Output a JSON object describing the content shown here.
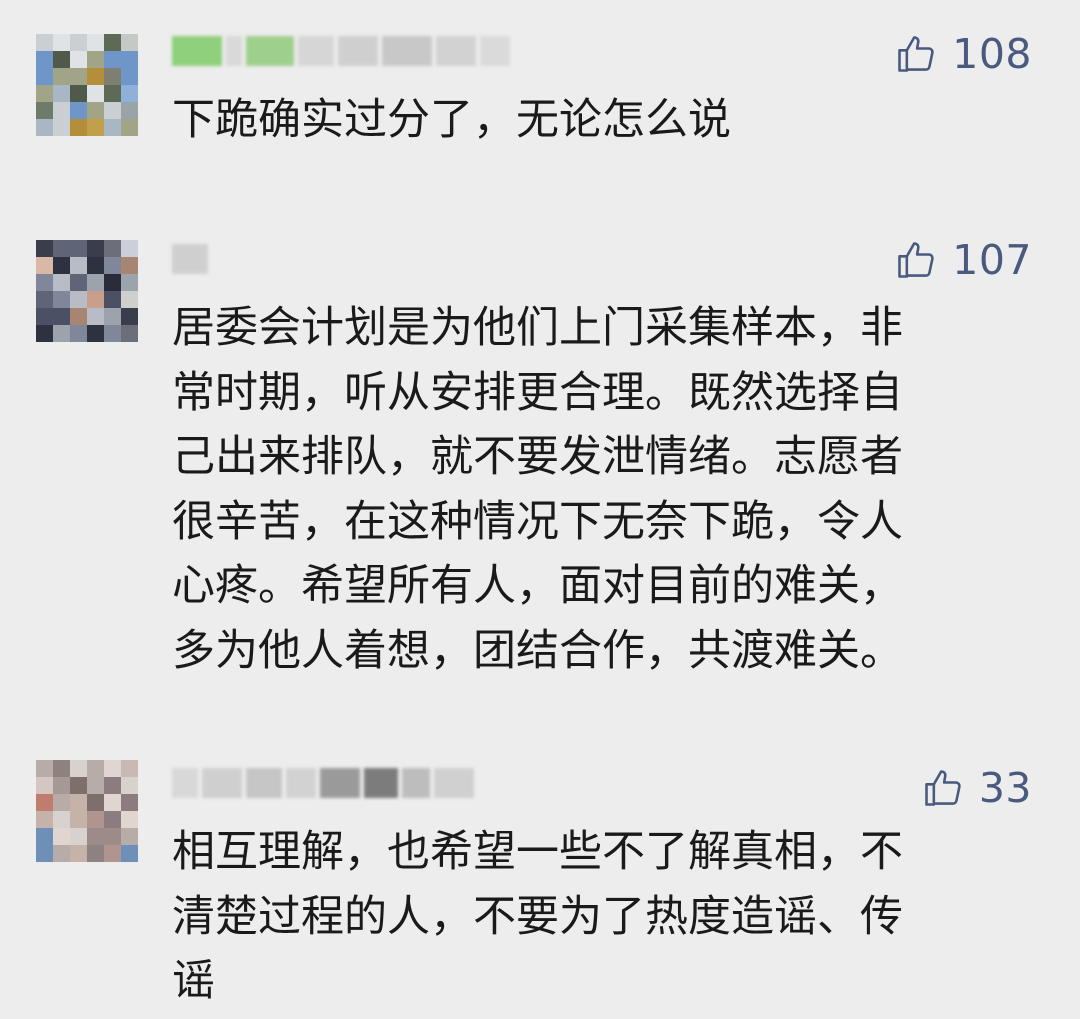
{
  "comments": [
    {
      "likes": "108",
      "lines": [
        "下跪确实过分了，无论怎么说"
      ]
    },
    {
      "likes": "107",
      "lines": [
        "居委会计划是为他们上门采集样本，非",
        "常时期，听从安排更合理。既然选择自",
        "己出来排队，就不要发泄情绪。志愿者",
        "很辛苦，在这种情况下无奈下跪，令人",
        "心疼。希望所有人，面对目前的难关，",
        "多为他人着想，团结合作，共渡难关。"
      ]
    },
    {
      "likes": "33",
      "lines": [
        "相互理解，也希望一些不了解真相，不",
        "清楚过程的人，不要为了热度造谣、传",
        "谣"
      ]
    }
  ],
  "icons": {
    "like": "thumbs-up-icon",
    "avatar": "pixelated-avatar",
    "username": "blurred-username"
  },
  "colors": {
    "background": "#ededed",
    "text": "#1a1a1a",
    "like": "#4a5a7e"
  }
}
